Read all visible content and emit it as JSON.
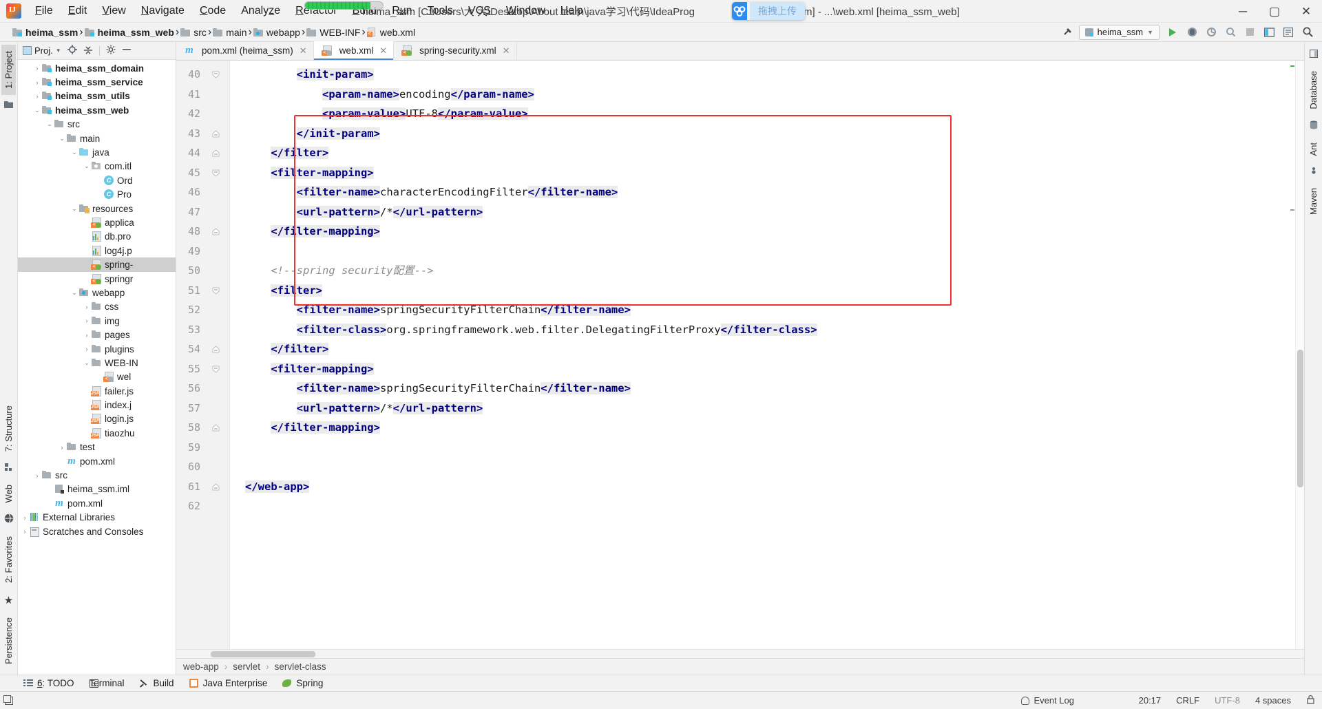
{
  "titlebar": {
    "window_title": "heima_ssm [C:\\Users\\大 大\\Desktop\\About learn\\java学习\\代码\\IdeaProg",
    "window_title_tail": "a_ssm] - ...\\web.xml [heima_ssm_web]",
    "upload_badge_label": "拖拽上传",
    "minimize": "─",
    "maximize": "▢",
    "close": "✕",
    "menu": [
      {
        "label": "File",
        "accel": "F"
      },
      {
        "label": "Edit",
        "accel": "E"
      },
      {
        "label": "View",
        "accel": "V"
      },
      {
        "label": "Navigate",
        "accel": "N"
      },
      {
        "label": "Code",
        "accel": "C"
      },
      {
        "label": "Analyze",
        "accel": "z"
      },
      {
        "label": "Refactor",
        "accel": "R"
      },
      {
        "label": "Build",
        "accel": "B"
      },
      {
        "label": "Run",
        "accel": "u"
      },
      {
        "label": "Tools",
        "accel": "T"
      },
      {
        "label": "VCS",
        "accel": "S"
      },
      {
        "label": "Window",
        "accel": "W"
      },
      {
        "label": "Help",
        "accel": "H"
      }
    ]
  },
  "navbar": {
    "breadcrumbs": [
      {
        "label": "heima_ssm",
        "icon": "module-folder-icon",
        "bold": true
      },
      {
        "label": "heima_ssm_web",
        "icon": "module-folder-icon",
        "bold": true
      },
      {
        "label": "src",
        "icon": "folder-icon",
        "bold": false
      },
      {
        "label": "main",
        "icon": "folder-icon",
        "bold": false
      },
      {
        "label": "webapp",
        "icon": "web-folder-icon",
        "bold": false
      },
      {
        "label": "WEB-INF",
        "icon": "folder-icon",
        "bold": false
      },
      {
        "label": "web.xml",
        "icon": "xml-file-icon",
        "bold": false
      }
    ],
    "run_config": "heima_ssm",
    "separator": "›"
  },
  "project_panel": {
    "title": "Proj.",
    "tree": [
      {
        "label": "heima_ssm_domain",
        "indent": 1,
        "arrow": "›",
        "icon": "module-folder-icon",
        "bold": true,
        "selected": false
      },
      {
        "label": "heima_ssm_service",
        "indent": 1,
        "arrow": "›",
        "icon": "module-folder-icon",
        "bold": true,
        "selected": false
      },
      {
        "label": "heima_ssm_utils",
        "indent": 1,
        "arrow": "›",
        "icon": "module-folder-icon",
        "bold": true,
        "selected": false
      },
      {
        "label": "heima_ssm_web",
        "indent": 1,
        "arrow": "⌄",
        "icon": "module-folder-icon",
        "bold": true,
        "selected": false
      },
      {
        "label": "src",
        "indent": 2,
        "arrow": "⌄",
        "icon": "folder-icon",
        "bold": false,
        "selected": false
      },
      {
        "label": "main",
        "indent": 3,
        "arrow": "⌄",
        "icon": "folder-icon",
        "bold": false,
        "selected": false
      },
      {
        "label": "java",
        "indent": 4,
        "arrow": "⌄",
        "icon": "source-folder-icon",
        "bold": false,
        "selected": false
      },
      {
        "label": "com.itl",
        "indent": 5,
        "arrow": "⌄",
        "icon": "package-icon",
        "bold": false,
        "selected": false
      },
      {
        "label": "Ord",
        "indent": 6,
        "arrow": "",
        "icon": "java-class-icon",
        "bold": false,
        "selected": false
      },
      {
        "label": "Pro",
        "indent": 6,
        "arrow": "",
        "icon": "java-class-icon",
        "bold": false,
        "selected": false
      },
      {
        "label": "resources",
        "indent": 4,
        "arrow": "⌄",
        "icon": "resources-folder-icon",
        "bold": false,
        "selected": false
      },
      {
        "label": "applica",
        "indent": 5,
        "arrow": "",
        "icon": "spring-xml-icon",
        "bold": false,
        "selected": false
      },
      {
        "label": "db.pro",
        "indent": 5,
        "arrow": "",
        "icon": "properties-icon",
        "bold": false,
        "selected": false
      },
      {
        "label": "log4j.p",
        "indent": 5,
        "arrow": "",
        "icon": "properties-icon",
        "bold": false,
        "selected": false
      },
      {
        "label": "spring-",
        "indent": 5,
        "arrow": "",
        "icon": "spring-xml-icon",
        "bold": false,
        "selected": true
      },
      {
        "label": "springr",
        "indent": 5,
        "arrow": "",
        "icon": "spring-xml-icon",
        "bold": false,
        "selected": false
      },
      {
        "label": "webapp",
        "indent": 4,
        "arrow": "⌄",
        "icon": "web-folder-icon",
        "bold": false,
        "selected": false
      },
      {
        "label": "css",
        "indent": 5,
        "arrow": "›",
        "icon": "folder-icon",
        "bold": false,
        "selected": false
      },
      {
        "label": "img",
        "indent": 5,
        "arrow": "›",
        "icon": "folder-icon",
        "bold": false,
        "selected": false
      },
      {
        "label": "pages",
        "indent": 5,
        "arrow": "›",
        "icon": "folder-icon",
        "bold": false,
        "selected": false
      },
      {
        "label": "plugins",
        "indent": 5,
        "arrow": "›",
        "icon": "folder-icon",
        "bold": false,
        "selected": false
      },
      {
        "label": "WEB-IN",
        "indent": 5,
        "arrow": "⌄",
        "icon": "folder-icon",
        "bold": false,
        "selected": false
      },
      {
        "label": "wel",
        "indent": 6,
        "arrow": "",
        "icon": "web-xml-icon",
        "bold": false,
        "selected": false
      },
      {
        "label": "failer.js",
        "indent": 5,
        "arrow": "",
        "icon": "jsp-icon",
        "bold": false,
        "selected": false
      },
      {
        "label": "index.j",
        "indent": 5,
        "arrow": "",
        "icon": "jsp-icon",
        "bold": false,
        "selected": false
      },
      {
        "label": "login.js",
        "indent": 5,
        "arrow": "",
        "icon": "jsp-icon",
        "bold": false,
        "selected": false
      },
      {
        "label": "tiaozhu",
        "indent": 5,
        "arrow": "",
        "icon": "jsp-icon",
        "bold": false,
        "selected": false
      },
      {
        "label": "test",
        "indent": 3,
        "arrow": "›",
        "icon": "folder-icon",
        "bold": false,
        "selected": false
      },
      {
        "label": "pom.xml",
        "indent": 3,
        "arrow": "",
        "icon": "maven-icon",
        "bold": false,
        "selected": false
      },
      {
        "label": "src",
        "indent": 1,
        "arrow": "›",
        "icon": "folder-icon",
        "bold": false,
        "selected": false
      },
      {
        "label": "heima_ssm.iml",
        "indent": 2,
        "arrow": "",
        "icon": "iml-icon",
        "bold": false,
        "selected": false
      },
      {
        "label": "pom.xml",
        "indent": 2,
        "arrow": "",
        "icon": "maven-icon",
        "bold": false,
        "selected": false
      },
      {
        "label": "External Libraries",
        "indent": 0,
        "arrow": "›",
        "icon": "library-icon",
        "bold": false,
        "selected": false
      },
      {
        "label": "Scratches and Consoles",
        "indent": 0,
        "arrow": "›",
        "icon": "scratch-icon",
        "bold": false,
        "selected": false
      }
    ]
  },
  "left_rail": [
    {
      "label": "1: Project",
      "selected": true,
      "name": "tool-window-project"
    }
  ],
  "left_rail_bottom": [
    {
      "label": "7: Structure",
      "name": "tool-window-structure"
    },
    {
      "label": "Web",
      "name": "tool-window-web"
    },
    {
      "label": "2: Favorites",
      "name": "tool-window-favorites"
    },
    {
      "label": "Persistence",
      "name": "tool-window-persistence"
    }
  ],
  "right_rail": [
    {
      "label": "Database",
      "name": "tool-window-database"
    },
    {
      "label": "Ant",
      "name": "tool-window-ant"
    },
    {
      "label": "Maven",
      "name": "tool-window-maven"
    }
  ],
  "editor": {
    "tabs": [
      {
        "label": "pom.xml (heima_ssm)",
        "icon": "maven-icon",
        "active": false,
        "close": "✕"
      },
      {
        "label": "web.xml",
        "icon": "web-xml-icon",
        "active": true,
        "close": "✕"
      },
      {
        "label": "spring-security.xml",
        "icon": "spring-xml-icon",
        "active": false,
        "close": "✕"
      }
    ],
    "first_line_number": 40,
    "lines": [
      {
        "num": 40,
        "indent": 8,
        "fold": "down",
        "segments": [
          {
            "t": "tag",
            "v": "<init-param>",
            "hl": true
          }
        ]
      },
      {
        "num": 41,
        "indent": 12,
        "fold": "",
        "segments": [
          {
            "t": "tag",
            "v": "<param-name>",
            "hl": true
          },
          {
            "t": "txt",
            "v": "encoding",
            "hl": false
          },
          {
            "t": "tag",
            "v": "</param-name>",
            "hl": true
          }
        ]
      },
      {
        "num": 42,
        "indent": 12,
        "fold": "",
        "segments": [
          {
            "t": "tag",
            "v": "<param-value>",
            "hl": true
          },
          {
            "t": "txt",
            "v": "UTF-8",
            "hl": false
          },
          {
            "t": "tag",
            "v": "</param-value>",
            "hl": true
          }
        ]
      },
      {
        "num": 43,
        "indent": 8,
        "fold": "up",
        "segments": [
          {
            "t": "tag",
            "v": "</init-param>",
            "hl": true
          }
        ]
      },
      {
        "num": 44,
        "indent": 4,
        "fold": "up",
        "segments": [
          {
            "t": "tag",
            "v": "</filter>",
            "hl": true
          }
        ]
      },
      {
        "num": 45,
        "indent": 4,
        "fold": "down",
        "segments": [
          {
            "t": "tag",
            "v": "<filter-mapping>",
            "hl": true
          }
        ]
      },
      {
        "num": 46,
        "indent": 8,
        "fold": "",
        "segments": [
          {
            "t": "tag",
            "v": "<filter-name>",
            "hl": true
          },
          {
            "t": "txt",
            "v": "characterEncodingFilter",
            "hl": false
          },
          {
            "t": "tag",
            "v": "</filter-name>",
            "hl": true
          }
        ]
      },
      {
        "num": 47,
        "indent": 8,
        "fold": "",
        "segments": [
          {
            "t": "tag",
            "v": "<url-pattern>",
            "hl": true
          },
          {
            "t": "txt",
            "v": "/*",
            "hl": false
          },
          {
            "t": "tag",
            "v": "</url-pattern>",
            "hl": true
          }
        ]
      },
      {
        "num": 48,
        "indent": 4,
        "fold": "up",
        "segments": [
          {
            "t": "tag",
            "v": "</filter-mapping>",
            "hl": true
          }
        ]
      },
      {
        "num": 49,
        "indent": 0,
        "fold": "",
        "segments": []
      },
      {
        "num": 50,
        "indent": 4,
        "fold": "",
        "segments": [
          {
            "t": "cmt",
            "v": "<!--spring security配置-->",
            "hl": false
          }
        ]
      },
      {
        "num": 51,
        "indent": 4,
        "fold": "down",
        "segments": [
          {
            "t": "tag",
            "v": "<filter>",
            "hl": true
          }
        ]
      },
      {
        "num": 52,
        "indent": 8,
        "fold": "",
        "segments": [
          {
            "t": "tag",
            "v": "<filter-name>",
            "hl": true
          },
          {
            "t": "txt",
            "v": "springSecurityFilterChain",
            "hl": false
          },
          {
            "t": "tag",
            "v": "</filter-name>",
            "hl": true
          }
        ]
      },
      {
        "num": 53,
        "indent": 8,
        "fold": "",
        "segments": [
          {
            "t": "tag",
            "v": "<filter-class>",
            "hl": true
          },
          {
            "t": "txt",
            "v": "org.springframework.web.filter.DelegatingFilterProxy",
            "hl": false
          },
          {
            "t": "tag",
            "v": "</filter-class>",
            "hl": true
          }
        ]
      },
      {
        "num": 54,
        "indent": 4,
        "fold": "up",
        "segments": [
          {
            "t": "tag",
            "v": "</filter>",
            "hl": true
          }
        ]
      },
      {
        "num": 55,
        "indent": 4,
        "fold": "down",
        "segments": [
          {
            "t": "tag",
            "v": "<filter-mapping>",
            "hl": true
          }
        ]
      },
      {
        "num": 56,
        "indent": 8,
        "fold": "",
        "segments": [
          {
            "t": "tag",
            "v": "<filter-name>",
            "hl": true
          },
          {
            "t": "txt",
            "v": "springSecurityFilterChain",
            "hl": false
          },
          {
            "t": "tag",
            "v": "</filter-name>",
            "hl": true
          }
        ]
      },
      {
        "num": 57,
        "indent": 8,
        "fold": "",
        "segments": [
          {
            "t": "tag",
            "v": "<url-pattern>",
            "hl": true
          },
          {
            "t": "txt",
            "v": "/*",
            "hl": false
          },
          {
            "t": "tag",
            "v": "</url-pattern>",
            "hl": true
          }
        ]
      },
      {
        "num": 58,
        "indent": 4,
        "fold": "up",
        "segments": [
          {
            "t": "tag",
            "v": "</filter-mapping>",
            "hl": true
          }
        ]
      },
      {
        "num": 59,
        "indent": 0,
        "fold": "",
        "segments": []
      },
      {
        "num": 60,
        "indent": 0,
        "fold": "",
        "segments": []
      },
      {
        "num": 61,
        "indent": 0,
        "fold": "up",
        "segments": [
          {
            "t": "tag",
            "v": "</web-app>",
            "hl": true
          }
        ]
      },
      {
        "num": 62,
        "indent": 0,
        "fold": "",
        "segments": []
      }
    ],
    "annotation_box_color": "#f03030",
    "breadcrumb": [
      "web-app",
      "servlet",
      "servlet-class"
    ],
    "breadcrumb_separator": "›"
  },
  "bottom_toolbar": [
    {
      "label": "6: TODO",
      "accel": "6",
      "icon": "todo-icon"
    },
    {
      "label": "Terminal",
      "accel": "",
      "icon": "terminal-icon"
    },
    {
      "label": "Build",
      "accel": "",
      "icon": "build-icon"
    },
    {
      "label": "Java Enterprise",
      "accel": "",
      "icon": "java-enterprise-icon"
    },
    {
      "label": "Spring",
      "accel": "",
      "icon": "spring-icon"
    }
  ],
  "statusbar": {
    "event_log": "Event Log",
    "time": "20:17",
    "line_separator": "CRLF",
    "encoding": "UTF-8",
    "indent": "4 spaces"
  }
}
